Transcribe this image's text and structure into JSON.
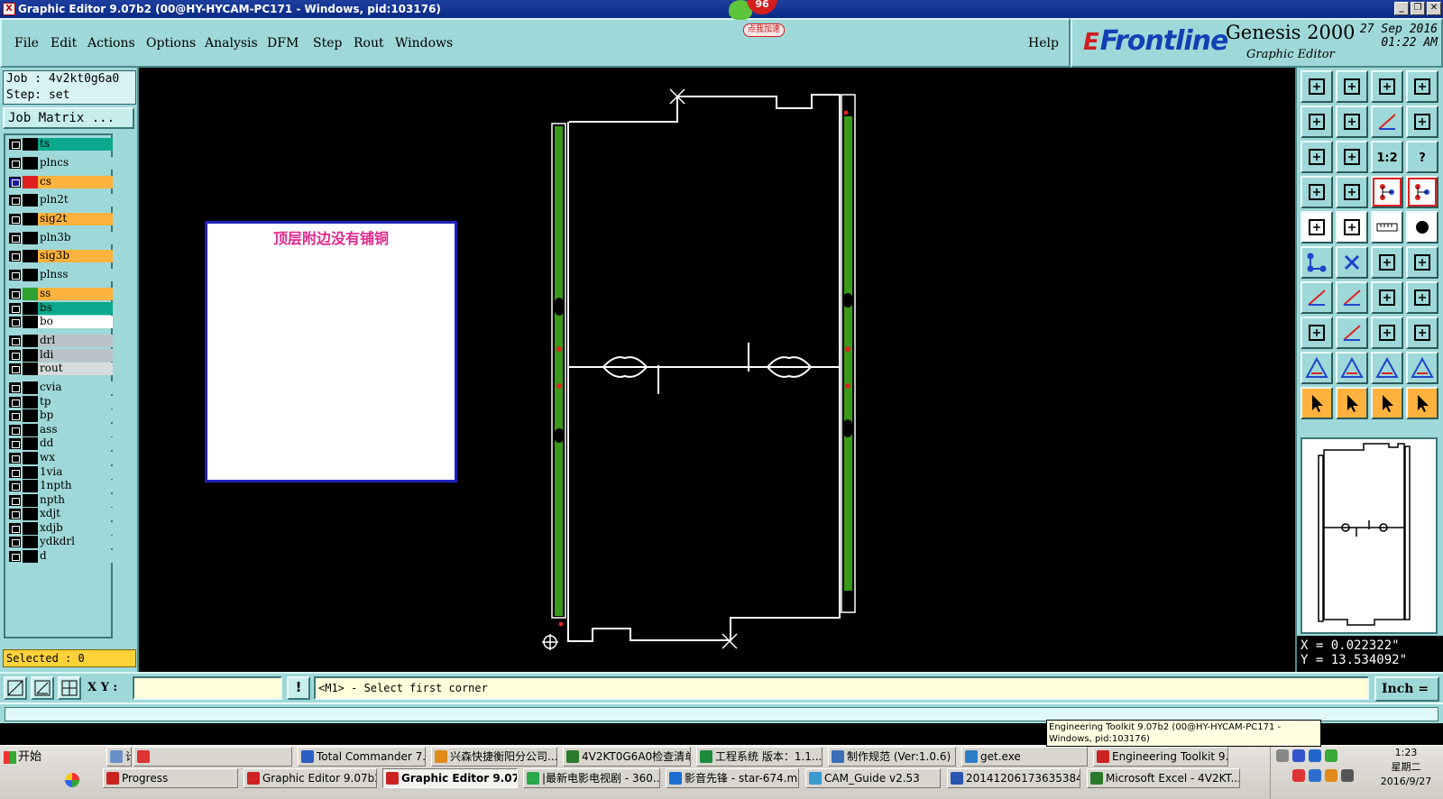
{
  "window": {
    "title": "Graphic Editor 9.07b2 (00@HY-HYCAM-PC171 - Windows, pid:103176)",
    "app_icon": "X"
  },
  "badge": {
    "count": "96",
    "tag": "点我加速"
  },
  "menu": {
    "items": [
      {
        "label": "File"
      },
      {
        "label": "Edit"
      },
      {
        "label": "Actions"
      },
      {
        "label": "Options"
      },
      {
        "label": "Analysis"
      },
      {
        "label": "DFM"
      },
      {
        "label": "Step"
      },
      {
        "label": "Rout"
      },
      {
        "label": "Windows"
      }
    ],
    "help": "Help"
  },
  "brand": {
    "logo_mark": "E",
    "logo_text": "Frontline",
    "product": "Genesis 2000",
    "subtitle": "Graphic Editor",
    "date": "27 Sep 2016",
    "time": "01:22 AM"
  },
  "job": {
    "job_line": "Job : 4v2kt0g6a0",
    "step_line": "Step: set",
    "matrix_button": "Job Matrix ..."
  },
  "layers": [
    {
      "name": "ts",
      "color": "#0aa88c",
      "swatch": "#000000"
    },
    {
      "name": "plncs",
      "color": "#9fd8d8",
      "swatch": "#000000"
    },
    {
      "name": "cs",
      "color": "#ffb23d",
      "swatch": "#e02020",
      "active": true
    },
    {
      "name": "pln2t",
      "color": "#9fd8d8",
      "swatch": "#000000"
    },
    {
      "name": "sig2t",
      "color": "#ffb23d",
      "swatch": "#000000"
    },
    {
      "name": "pln3b",
      "color": "#9fd8d8",
      "swatch": "#000000"
    },
    {
      "name": "sig3b",
      "color": "#ffb23d",
      "swatch": "#000000"
    },
    {
      "name": "plnss",
      "color": "#9fd8d8",
      "swatch": "#000000"
    },
    {
      "name": "ss",
      "color": "#ffb23d",
      "swatch": "#2fa12f"
    },
    {
      "name": "bs",
      "color": "#0aa88c",
      "swatch": "#000000"
    },
    {
      "name": "bo",
      "color": "#ffffff",
      "swatch": "#000000"
    },
    {
      "name": "drl",
      "color": "#b8c4c8",
      "swatch": "#000000"
    },
    {
      "name": "ldi",
      "color": "#b8c4c8",
      "swatch": "#000000"
    },
    {
      "name": "rout",
      "color": "#d8dcdc",
      "swatch": "#000000"
    },
    {
      "name": "cvia",
      "color": "#9fd8d8",
      "swatch": "#000000"
    },
    {
      "name": "tp",
      "color": "#9fd8d8",
      "swatch": "#000000"
    },
    {
      "name": "bp",
      "color": "#9fd8d8",
      "swatch": "#000000"
    },
    {
      "name": "ass",
      "color": "#9fd8d8",
      "swatch": "#000000"
    },
    {
      "name": "dd",
      "color": "#9fd8d8",
      "swatch": "#000000"
    },
    {
      "name": "wx",
      "color": "#9fd8d8",
      "swatch": "#000000"
    },
    {
      "name": "1via",
      "color": "#9fd8d8",
      "swatch": "#000000"
    },
    {
      "name": "1npth",
      "color": "#9fd8d8",
      "swatch": "#000000"
    },
    {
      "name": "npth",
      "color": "#9fd8d8",
      "swatch": "#000000"
    },
    {
      "name": "xdjt",
      "color": "#9fd8d8",
      "swatch": "#000000"
    },
    {
      "name": "xdjb",
      "color": "#9fd8d8",
      "swatch": "#000000"
    },
    {
      "name": "ydkdrl",
      "color": "#9fd8d8",
      "swatch": "#000000"
    },
    {
      "name": "d",
      "color": "#9fd8d8",
      "swatch": "#000000"
    }
  ],
  "selected": "Selected : 0",
  "note": {
    "text": "顶层附边没有铺铜"
  },
  "coords": {
    "x": "X = 0.022322\"",
    "y": "Y = 13.534092\""
  },
  "cmd": {
    "xy_label": "X Y :",
    "xy_value": "",
    "bang": "!",
    "prompt": "<M1> - Select first corner",
    "unit": "Inch"
  },
  "tooltip": "Engineering Toolkit 9.07b2 (00@HY-HYCAM-PC171 - Windows, pid:103176)",
  "taskbar": {
    "start": "开始",
    "row1": [
      {
        "label": "计算器",
        "icon": "calculator-icon",
        "color": "#6a8fc8"
      },
      {
        "label": "",
        "icon": "colorful-app-icon",
        "color": "#d33"
      },
      {
        "label": "Total Commander 7.0 ...",
        "icon": "floppy-icon",
        "color": "#2a5fc0"
      },
      {
        "label": "兴森快捷衡阳分公司...",
        "icon": "star-icon",
        "color": "#e08a1a"
      },
      {
        "label": "4V2KT0G6A0检查清单",
        "icon": "excel-icon",
        "color": "#2b7a2b"
      },
      {
        "label": "工程系统   版本：1.1...",
        "icon": "p-icon",
        "color": "#1b8a3b"
      },
      {
        "label": "制作规范 (Ver:1.0.6)",
        "icon": "document-icon",
        "color": "#3a6fb8"
      },
      {
        "label": "get.exe",
        "icon": "globe-icon",
        "color": "#2a7fc8"
      },
      {
        "label": "Engineering Toolkit 9....",
        "icon": "frontline-icon",
        "color": "#c22"
      }
    ],
    "row2": [
      {
        "label": "Progress",
        "icon": "frontline-icon",
        "color": "#c22"
      },
      {
        "label": "Graphic Editor 9.07b2 (0...",
        "icon": "frontline-icon",
        "color": "#c22"
      },
      {
        "label": "Graphic Editor 9.07b2...",
        "icon": "frontline-icon",
        "color": "#c22",
        "active": true
      },
      {
        "label": "|最新电影电视剧 - 360...",
        "icon": "360-browser-icon",
        "color": "#2aa84a"
      },
      {
        "label": "影音先锋 - star-674.mp4",
        "icon": "media-player-icon",
        "color": "#1a6fd0"
      },
      {
        "label": "CAM_Guide v2.53",
        "icon": "guide-icon",
        "color": "#3a9ad0"
      },
      {
        "label": "20141206173635384.rt...",
        "icon": "word-icon",
        "color": "#2a55b0"
      },
      {
        "label": "Microsoft Excel - 4V2KT...",
        "icon": "excel-icon",
        "color": "#2b7a2b"
      }
    ],
    "clock_time": "1:23",
    "clock_day": "星期二",
    "clock_date": "2016/9/27"
  }
}
